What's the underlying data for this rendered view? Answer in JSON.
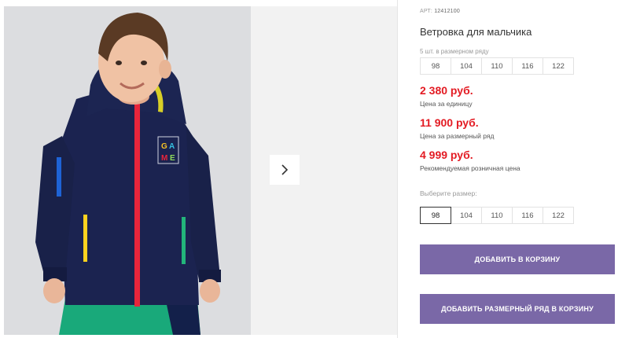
{
  "product": {
    "article_label": "АРТ:",
    "article_number": "12412100",
    "title": "Ветровка для мальчика",
    "range_note": "5 шт. в размерном ряду",
    "range_sizes": [
      "98",
      "104",
      "110",
      "116",
      "122"
    ],
    "prices": [
      {
        "value": "2 380 руб.",
        "label": "Цена за единицу"
      },
      {
        "value": "11 900 руб.",
        "label": "Цена за размерный ряд"
      },
      {
        "value": "4 999 руб.",
        "label": "Рекомендуемая розничная цена"
      }
    ],
    "choose_size_label": "Выберите размер:",
    "size_options": [
      "98",
      "104",
      "110",
      "116",
      "122"
    ],
    "selected_size": "98",
    "add_to_cart_label": "ДОБАВИТЬ В КОРЗИНУ",
    "add_range_label": "ДОБАВИТЬ РАЗМЕРНЫЙ РЯД В КОРЗИНУ"
  },
  "gallery": {
    "next_icon": "chevron-right-icon",
    "patch_letters": [
      "G",
      "A",
      "M",
      "E"
    ]
  },
  "colors": {
    "price": "#e31b23",
    "button": "#7a68a7",
    "jacket": "#1b2350",
    "zipper": "#e8253b"
  }
}
